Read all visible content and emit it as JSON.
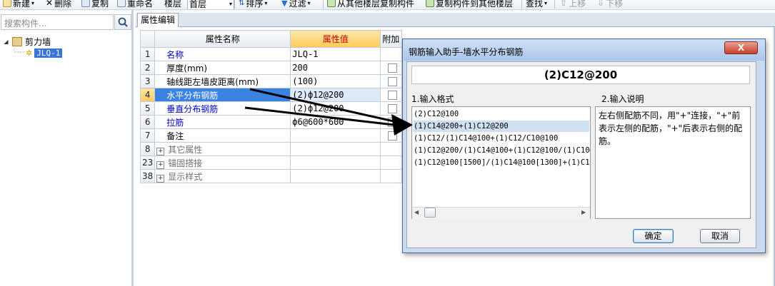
{
  "toolbar": {
    "new_label": "新建",
    "delete_label": "删除",
    "copy_label": "复制",
    "rename_label": "重命名",
    "floor_label": "楼层",
    "floor_value": "首层",
    "sort_label": "排序",
    "filter_label": "过滤",
    "copy_from_label": "从其他楼层复制构件",
    "copy_to_label": "复制构件到其他楼层",
    "find_label": "查找",
    "move_up_label": "上移",
    "move_down_label": "下移"
  },
  "left_panel": {
    "search_placeholder": "搜索构件...",
    "tree_root": "剪力墙",
    "tree_child": "JLQ-1"
  },
  "editor": {
    "tab_label": "属性编辑",
    "columns": {
      "name": "属性名称",
      "value": "属性值",
      "extra": "附加"
    },
    "rows": [
      {
        "num": "1",
        "name": "名称",
        "value": "JLQ-1"
      },
      {
        "num": "2",
        "name": "厚度(mm)",
        "value": "200"
      },
      {
        "num": "3",
        "name": "轴线距左墙皮距离(mm)",
        "value": "(100)"
      },
      {
        "num": "4",
        "name": "水平分布钢筋",
        "value": "(2)ф12@200"
      },
      {
        "num": "5",
        "name": "垂直分布钢筋",
        "value": "(2)ф12@200"
      },
      {
        "num": "6",
        "name": "拉筋",
        "value": "ф6@600*600"
      },
      {
        "num": "7",
        "name": "备注",
        "value": ""
      },
      {
        "num": "8",
        "name": "其它属性",
        "value": ""
      },
      {
        "num": "23",
        "name": "锚固搭接",
        "value": ""
      },
      {
        "num": "38",
        "name": "显示样式",
        "value": ""
      }
    ]
  },
  "dialog": {
    "title": "钢筋输入助手-墙水平分布钢筋",
    "close_label": "X",
    "formula": "(2)C12@200",
    "format_label": "1.输入格式",
    "explain_label": "2.输入说明",
    "formats": [
      "(2)C12@100",
      "(1)C14@200+(1)C12@200",
      "(1)C12/(1)C14@100+(1)C12/C10@100",
      "(1)C12@200/(1)C14@100+(1)C12@100/(1)C10@2",
      "(1)C12@100[1500]/(1)C14@100[1300]+(1)C12@"
    ],
    "explanation": "左右侧配筋不同，用\"+\"连接，\"+\"前表示左侧的配筋，\"+\"后表示右侧的配筋。",
    "ok_label": "确定",
    "cancel_label": "取消"
  },
  "colors": {
    "selection": "#3b83e0",
    "header_highlight": "#ffc95c",
    "dialog_frame": "#cbdaf0",
    "close_button": "#c6402c",
    "link_text": "#0000c8"
  }
}
